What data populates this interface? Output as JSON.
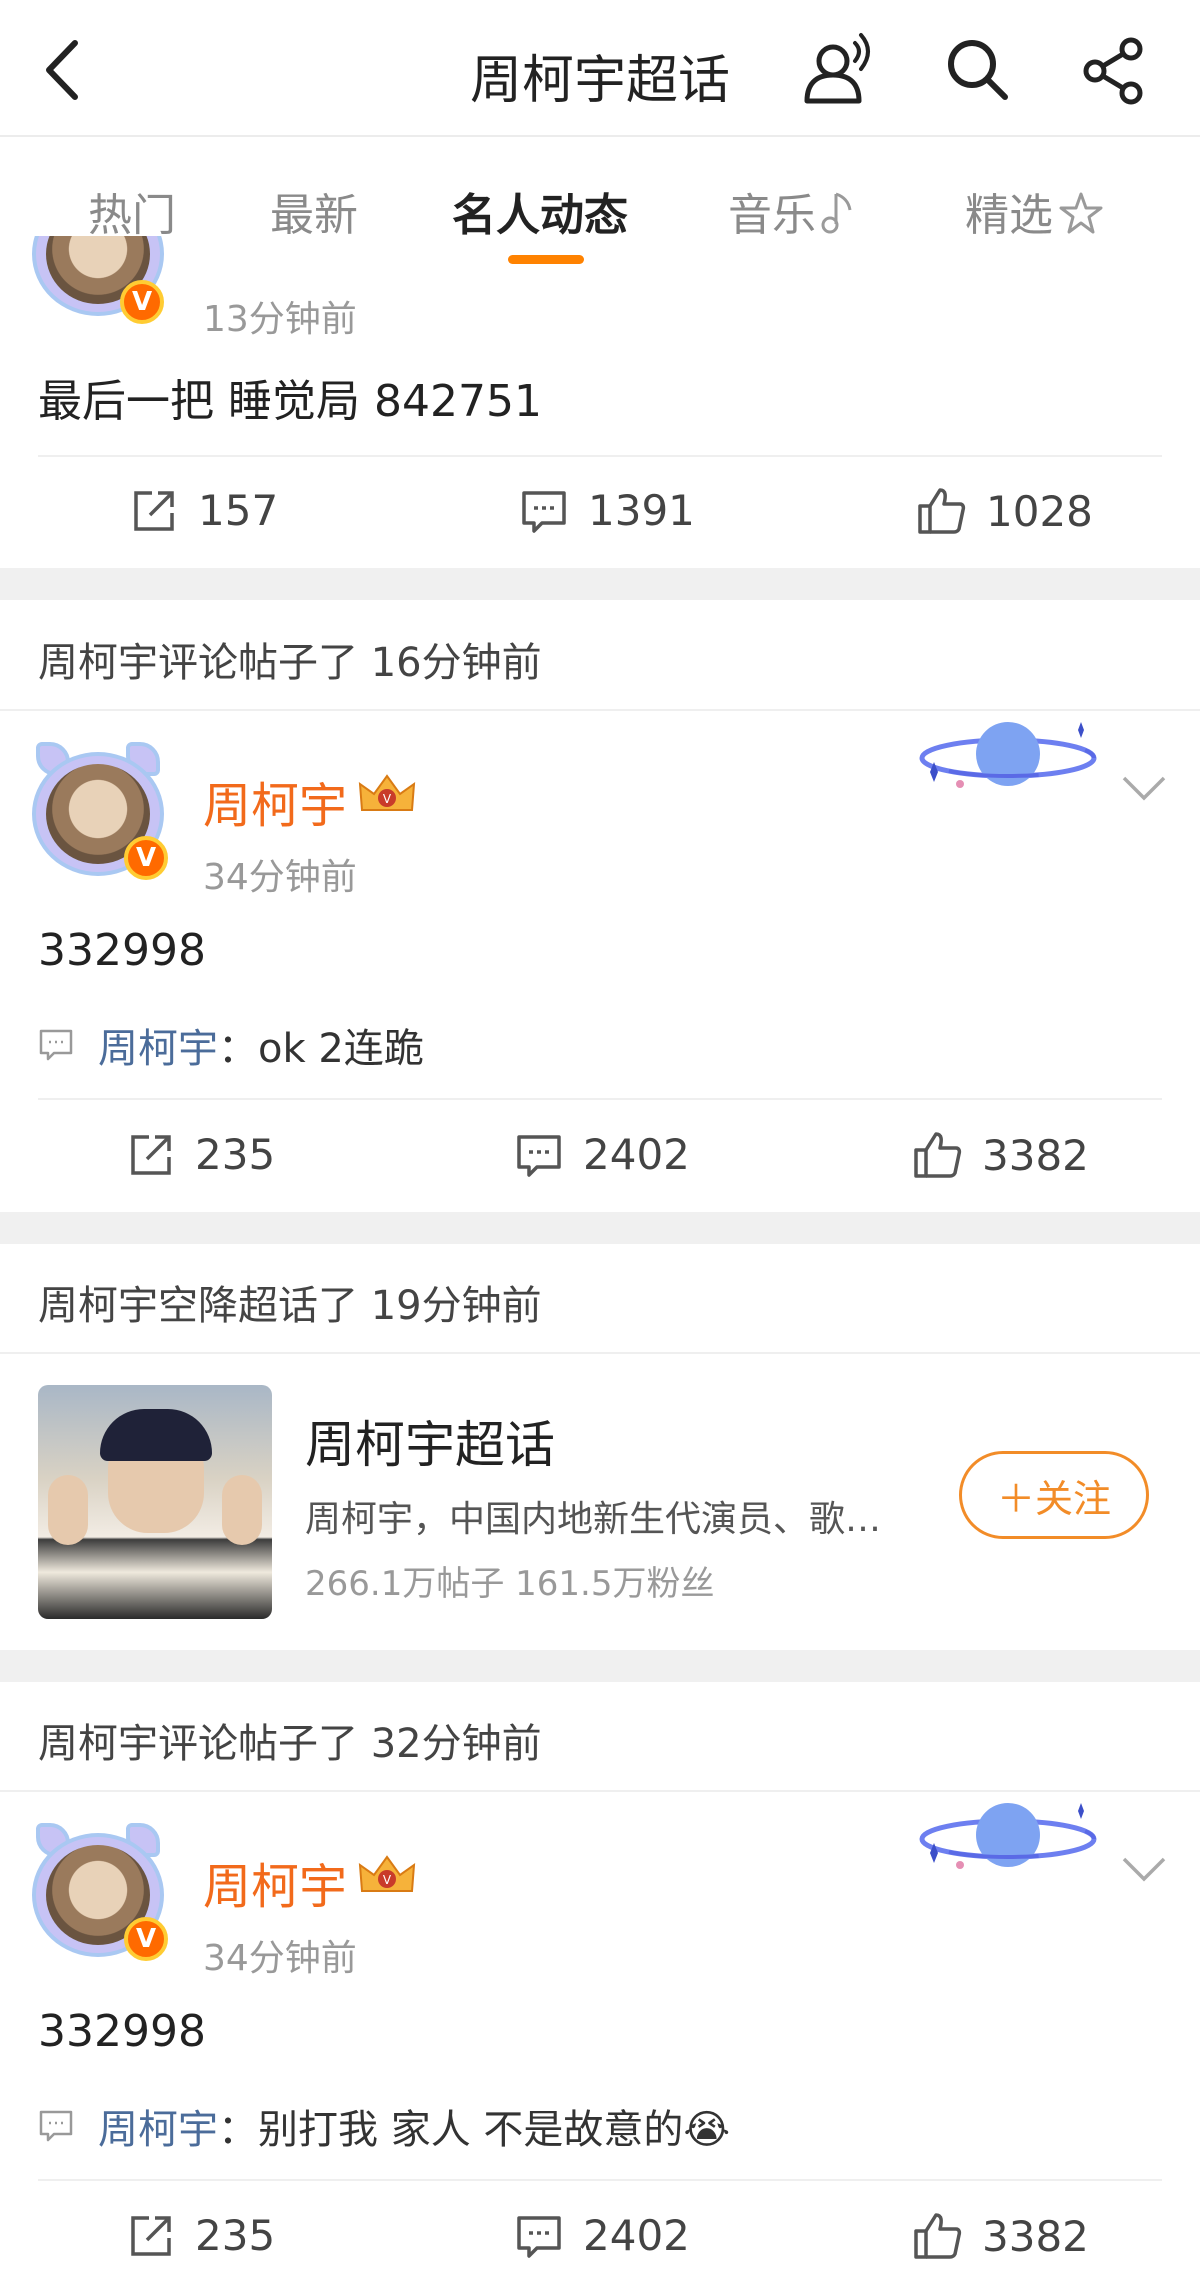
{
  "header": {
    "title": "周柯宇超话",
    "icons": [
      "back-icon",
      "user-voice-icon",
      "search-icon",
      "share-icon"
    ]
  },
  "tabs": [
    {
      "label": "热门",
      "active": false
    },
    {
      "label": "最新",
      "active": false
    },
    {
      "label": "名人动态",
      "active": true
    },
    {
      "label": "音乐",
      "active": false,
      "icon": "music-note-icon"
    },
    {
      "label": "精选",
      "active": false,
      "icon": "star-icon"
    }
  ],
  "accent_color": "#ff8200",
  "posts": [
    {
      "time": "13分钟前",
      "text": "最后一把 睡觉局 842751",
      "repost": "157",
      "comments": "1391",
      "likes": "1028"
    },
    {
      "section": "周柯宇评论帖子了 16分钟前",
      "name": "周柯宇",
      "time": "34分钟前",
      "text": "332998",
      "comment_author": "周柯宇",
      "comment_text": "：ok 2连跪",
      "repost": "235",
      "comments": "2402",
      "likes": "3382"
    },
    {
      "section": "周柯宇评论帖子了 32分钟前",
      "name": "周柯宇",
      "time": "34分钟前",
      "text": "332998",
      "comment_author": "周柯宇",
      "comment_text": "：别打我 家人 不是故意的😭",
      "repost": "235",
      "comments": "2402",
      "likes": "3382"
    }
  ],
  "topic": {
    "section": "周柯宇空降超话了 19分钟前",
    "title": "周柯宇超话",
    "desc": "周柯宇，中国内地新生代演员、歌…",
    "stats": "266.1万帖子  161.5万粉丝",
    "follow_label": "＋关注"
  }
}
